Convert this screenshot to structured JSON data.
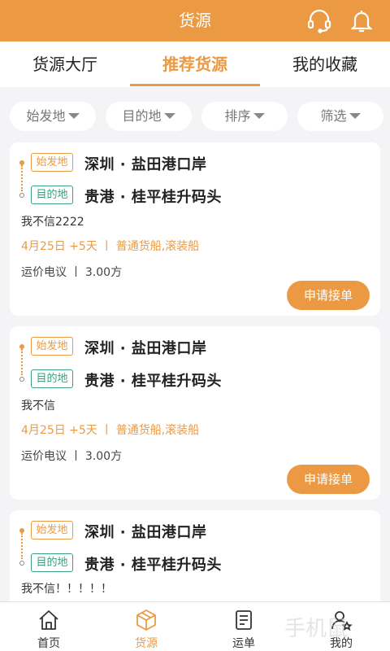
{
  "header": {
    "title": "货源",
    "icons": [
      "headset-icon",
      "bell-icon"
    ]
  },
  "tabs": [
    {
      "label": "货源大厅",
      "active": false
    },
    {
      "label": "推荐货源",
      "active": true
    },
    {
      "label": "我的收藏",
      "active": false
    }
  ],
  "filters": [
    {
      "label": "始发地"
    },
    {
      "label": "目的地"
    },
    {
      "label": "排序"
    },
    {
      "label": "筛选"
    }
  ],
  "cards": [
    {
      "origin_tag": "始发地",
      "origin": "深圳 · 盐田港口岸",
      "dest_tag": "目的地",
      "dest": "贵港 · 桂平桂升码头",
      "remark": "我不信2222",
      "meta": "4月25日 +5天 丨 普通货船,滚装船",
      "price": "运价电议 丨 3.00方",
      "action": "申请接单"
    },
    {
      "origin_tag": "始发地",
      "origin": "深圳 · 盐田港口岸",
      "dest_tag": "目的地",
      "dest": "贵港 · 桂平桂升码头",
      "remark": "我不信",
      "meta": "4月25日 +5天 丨 普通货船,滚装船",
      "price": "运价电议 丨 3.00方",
      "action": "申请接单"
    },
    {
      "origin_tag": "始发地",
      "origin": "深圳 · 盐田港口岸",
      "dest_tag": "目的地",
      "dest": "贵港 · 桂平桂升码头",
      "remark": "我不信！！！！！"
    }
  ],
  "bottom_nav": [
    {
      "label": "首页",
      "icon": "home-icon",
      "active": false
    },
    {
      "label": "货源",
      "icon": "cargo-box-icon",
      "active": true
    },
    {
      "label": "运单",
      "icon": "waybill-icon",
      "active": false
    },
    {
      "label": "我的",
      "icon": "profile-icon",
      "active": false
    }
  ],
  "watermark": "手机鼠",
  "colors": {
    "accent": "#eb9a43",
    "dest_green": "#3aa07a",
    "background": "#f4f4f6"
  }
}
